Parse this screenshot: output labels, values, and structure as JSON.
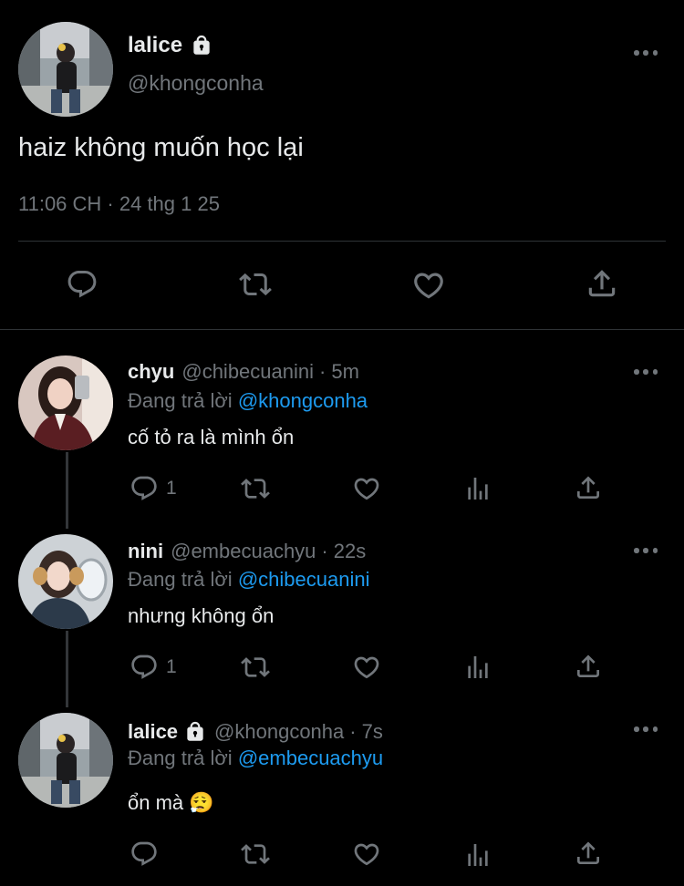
{
  "main": {
    "name": "lalice",
    "handle": "@khongconha",
    "text": "haiz không muốn học lại",
    "meta": "11:06 CH · 24 thg 1 25"
  },
  "replies": [
    {
      "name": "chyu",
      "handle": "@chibecuanini",
      "time": "5m",
      "reply_prefix": "Đang trả lời",
      "mention": "@khongconha",
      "text": "cố tỏ ra là mình ổn",
      "reply_count": "1"
    },
    {
      "name": "nini",
      "handle": "@embecuachyu",
      "time": "22s",
      "reply_prefix": "Đang trả lời",
      "mention": "@chibecuanini",
      "text": "nhưng không ổn",
      "reply_count": "1"
    },
    {
      "name": "lalice",
      "handle": "@khongconha",
      "time": "7s",
      "reply_prefix": "Đang trả lời",
      "mention": "@embecuachyu",
      "text": "ổn mà",
      "emoji": "😮‍💨"
    }
  ],
  "colors": {
    "background": "#000000",
    "text": "#e7e9ea",
    "secondary": "#71767b",
    "accent": "#1d9bf0",
    "divider": "#2f3336"
  },
  "icons": [
    "more-icon",
    "lock-icon",
    "reply-icon",
    "retweet-icon",
    "like-icon",
    "views-icon",
    "share-icon"
  ]
}
